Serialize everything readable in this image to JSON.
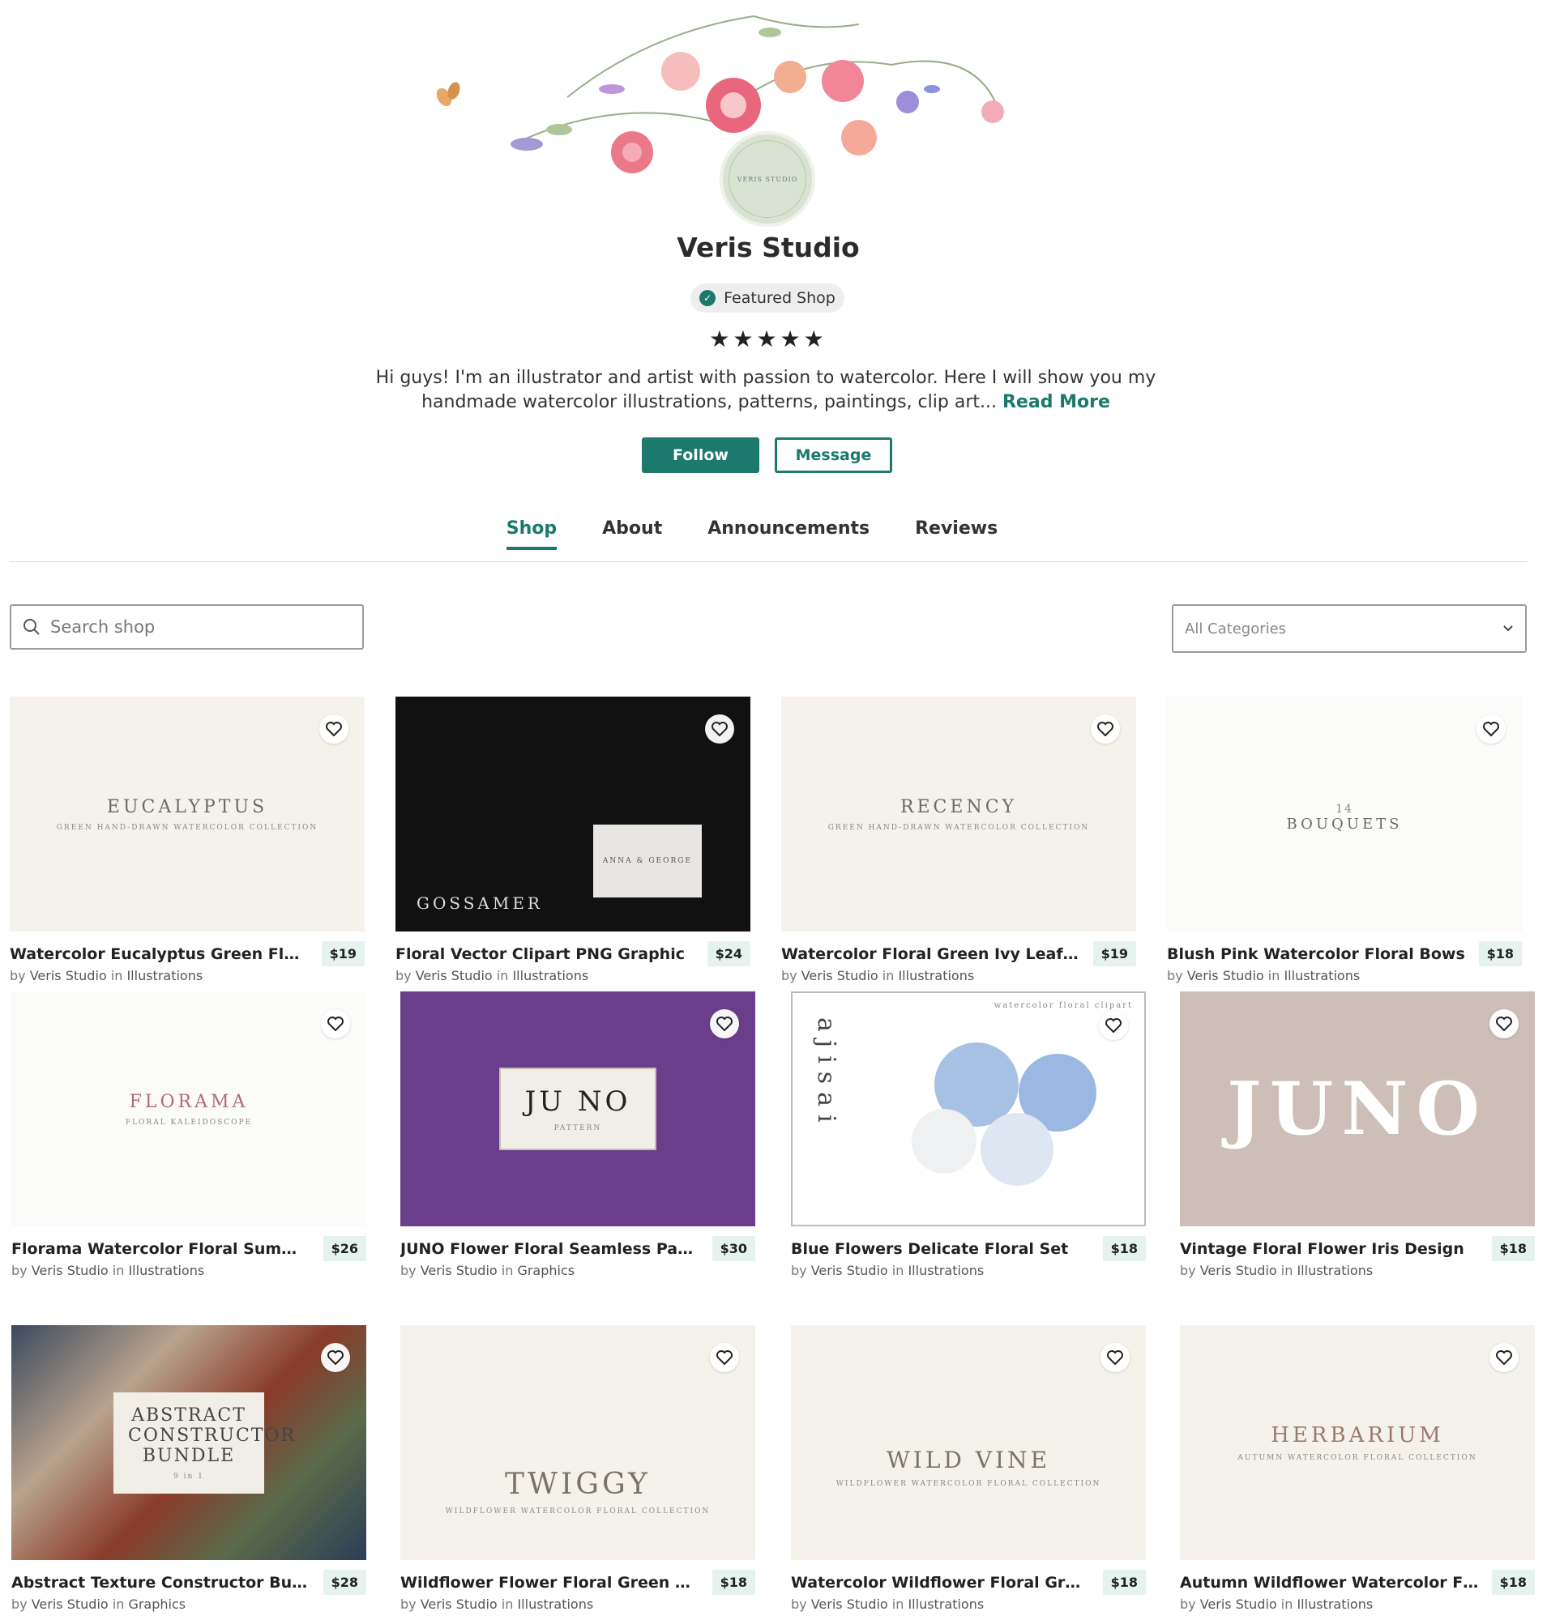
{
  "shop": {
    "name": "Veris Studio",
    "featured_label": "Featured Shop",
    "stars": "★★★★★",
    "avatar_text": "VERIS STUDIO",
    "bio": "Hi guys! I'm an illustrator and artist with passion to watercolor. Here I will show you my handmade watercolor illustrations, patterns, paintings, clip art...",
    "read_more": "Read More",
    "follow_label": "Follow",
    "message_label": "Message"
  },
  "tabs": [
    {
      "label": "Shop",
      "active": true
    },
    {
      "label": "About"
    },
    {
      "label": "Announcements"
    },
    {
      "label": "Reviews"
    }
  ],
  "search": {
    "placeholder": "Search shop"
  },
  "category_select": {
    "selected": "All Categories"
  },
  "colors": {
    "accent": "#1b7a6c",
    "price_bg": "#e6f2ef"
  },
  "products": [
    {
      "title": "Watercolor Eucalyptus Green Floral",
      "price": "$19",
      "by": "by",
      "author": "Veris Studio",
      "in": "in",
      "category": "Illustrations",
      "image_text": "EUCALYPTUS",
      "image_subtext": "GREEN HAND-DRAWN WATERCOLOR COLLECTION"
    },
    {
      "title": "Floral Vector Clipart PNG Graphic",
      "price": "$24",
      "by": "by",
      "author": "Veris Studio",
      "in": "in",
      "category": "Illustrations",
      "image_text": "GOSSAMER",
      "image_subtext": "ANNA & GEORGE"
    },
    {
      "title": "Watercolor Floral Green Ivy Leaf Set",
      "price": "$19",
      "by": "by",
      "author": "Veris Studio",
      "in": "in",
      "category": "Illustrations",
      "image_text": "RECENCY",
      "image_subtext": "GREEN HAND-DRAWN WATERCOLOR COLLECTION"
    },
    {
      "title": "Blush Pink Watercolor Floral Bows",
      "price": "$18",
      "by": "by",
      "author": "Veris Studio",
      "in": "in",
      "category": "Illustrations",
      "image_text": "BOUQUETS",
      "image_subtext": "14"
    },
    {
      "title": "Florama Watercolor Floral Summer ...",
      "price": "$26",
      "by": "by",
      "author": "Veris Studio",
      "in": "in",
      "category": "Illustrations",
      "image_text": "FLORAMA",
      "image_subtext": "FLORAL KALEIDOSCOPE"
    },
    {
      "title": "JUNO Flower Floral Seamless Pattern",
      "price": "$30",
      "by": "by",
      "author": "Veris Studio",
      "in": "in",
      "category": "Graphics",
      "image_text": "JU NO",
      "image_subtext": "PATTERN"
    },
    {
      "title": "Blue Flowers Delicate Floral Set",
      "price": "$18",
      "by": "by",
      "author": "Veris Studio",
      "in": "in",
      "category": "Illustrations",
      "image_text": "ajisai",
      "image_subtext": "watercolor floral clipart"
    },
    {
      "title": "Vintage Floral Flower Iris Design",
      "price": "$18",
      "by": "by",
      "author": "Veris Studio",
      "in": "in",
      "category": "Illustrations",
      "image_text": "JUNO",
      "image_subtext": ""
    },
    {
      "title": "Abstract Texture Constructor Bundle",
      "price": "$28",
      "by": "by",
      "author": "Veris Studio",
      "in": "in",
      "category": "Graphics",
      "image_text": "ABSTRACT CONSTRUCTOR BUNDLE",
      "image_subtext": "9 in 1"
    },
    {
      "title": "Wildflower Flower Floral Green Set",
      "price": "$18",
      "by": "by",
      "author": "Veris Studio",
      "in": "in",
      "category": "Illustrations",
      "image_text": "TWIGGY",
      "image_subtext": "WILDFLOWER WATERCOLOR FLORAL COLLECTION"
    },
    {
      "title": "Watercolor Wildflower Floral Green",
      "price": "$18",
      "by": "by",
      "author": "Veris Studio",
      "in": "in",
      "category": "Illustrations",
      "image_text": "WILD VINE",
      "image_subtext": "WILDFLOWER WATERCOLOR FLORAL COLLECTION"
    },
    {
      "title": "Autumn Wildflower Watercolor Floral",
      "price": "$18",
      "by": "by",
      "author": "Veris Studio",
      "in": "in",
      "category": "Illustrations",
      "image_text": "HERBARIUM",
      "image_subtext": "AUTUMN WATERCOLOR FLORAL COLLECTION"
    }
  ]
}
